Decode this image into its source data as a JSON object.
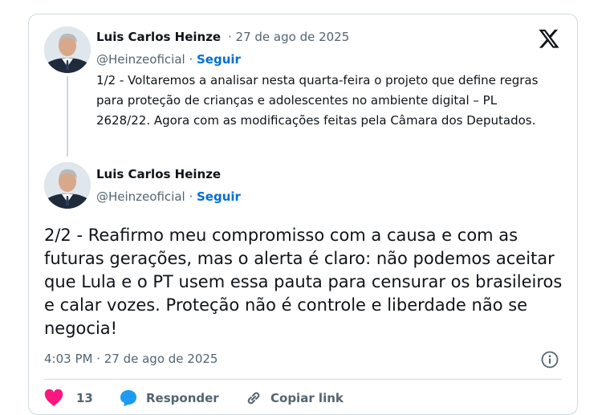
{
  "tweet1": {
    "author_name": "Luis Carlos Heinze",
    "date": "27 de ago de 2025",
    "handle": "@Heinzeoficial",
    "follow_label": "Seguir",
    "text": "1/2 - Voltaremos a analisar nesta quarta-feira o projeto que define regras para proteção de crianças e adolescentes no ambiente digital – PL 2628/22. Agora com as modificações feitas pela Câmara dos Deputados."
  },
  "tweet2": {
    "author_name": "Luis Carlos Heinze",
    "handle": "@Heinzeoficial",
    "follow_label": "Seguir",
    "text": "2/2 - Reafirmo meu compromisso com a causa e com as futuras gerações, mas o alerta é claro: não podemos aceitar que Lula e o PT usem essa pauta para censurar os brasileiros e calar vozes. Proteção não é controle e liberdade não se negocia!",
    "timestamp": "4:03 PM · 27 de ago de 2025"
  },
  "actions": {
    "like_count": "13",
    "reply_label": "Responder",
    "copy_link_label": "Copiar link"
  },
  "icons": {
    "brand": "x-logo-icon",
    "info": "info-icon",
    "like": "heart-icon",
    "reply": "reply-bubble-icon",
    "copy_link": "link-icon"
  },
  "colors": {
    "follow": "#006fd6",
    "muted_text": "#536471",
    "heart": "#f91880",
    "reply_icon": "#1d9bf0"
  }
}
